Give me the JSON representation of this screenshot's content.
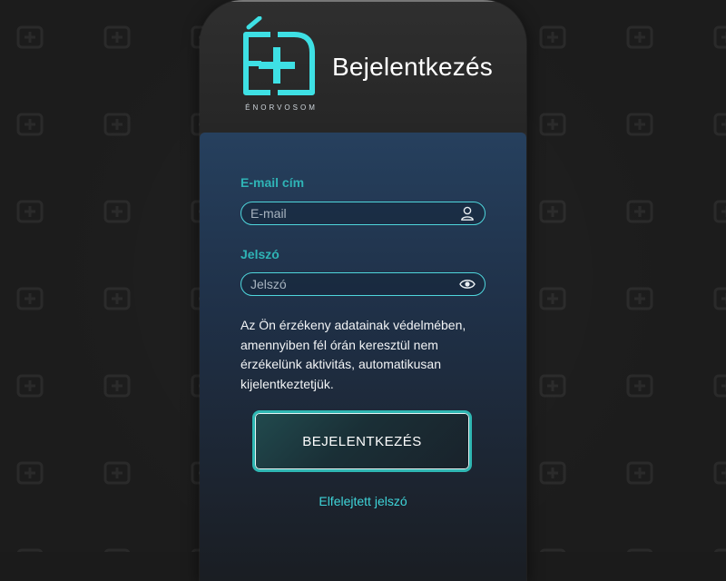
{
  "header": {
    "logo_caption": "ÉNORVOSOM",
    "title": "Bejelentkezés"
  },
  "form": {
    "email_label": "E-mail cím",
    "email_placeholder": "E-mail",
    "email_value": "",
    "email_icon": "user-icon",
    "password_label": "Jelszó",
    "password_placeholder": "Jelszó",
    "password_value": "",
    "password_icon": "eye-icon",
    "notice": "Az Ön érzékeny adatainak védelmében, amennyiben fél órán keresztül nem érzékelünk aktivitás, automatikusan kijelentkeztetjük.",
    "submit_label": "BEJELENTKEZÉS",
    "forgot_label": "Elfelejtett jelszó"
  },
  "colors": {
    "accent": "#3fd5d9",
    "label": "#2fb4b6",
    "card_top": "#2a2a2a",
    "card_body_top": "#26405e",
    "background": "#1c1c1c"
  }
}
